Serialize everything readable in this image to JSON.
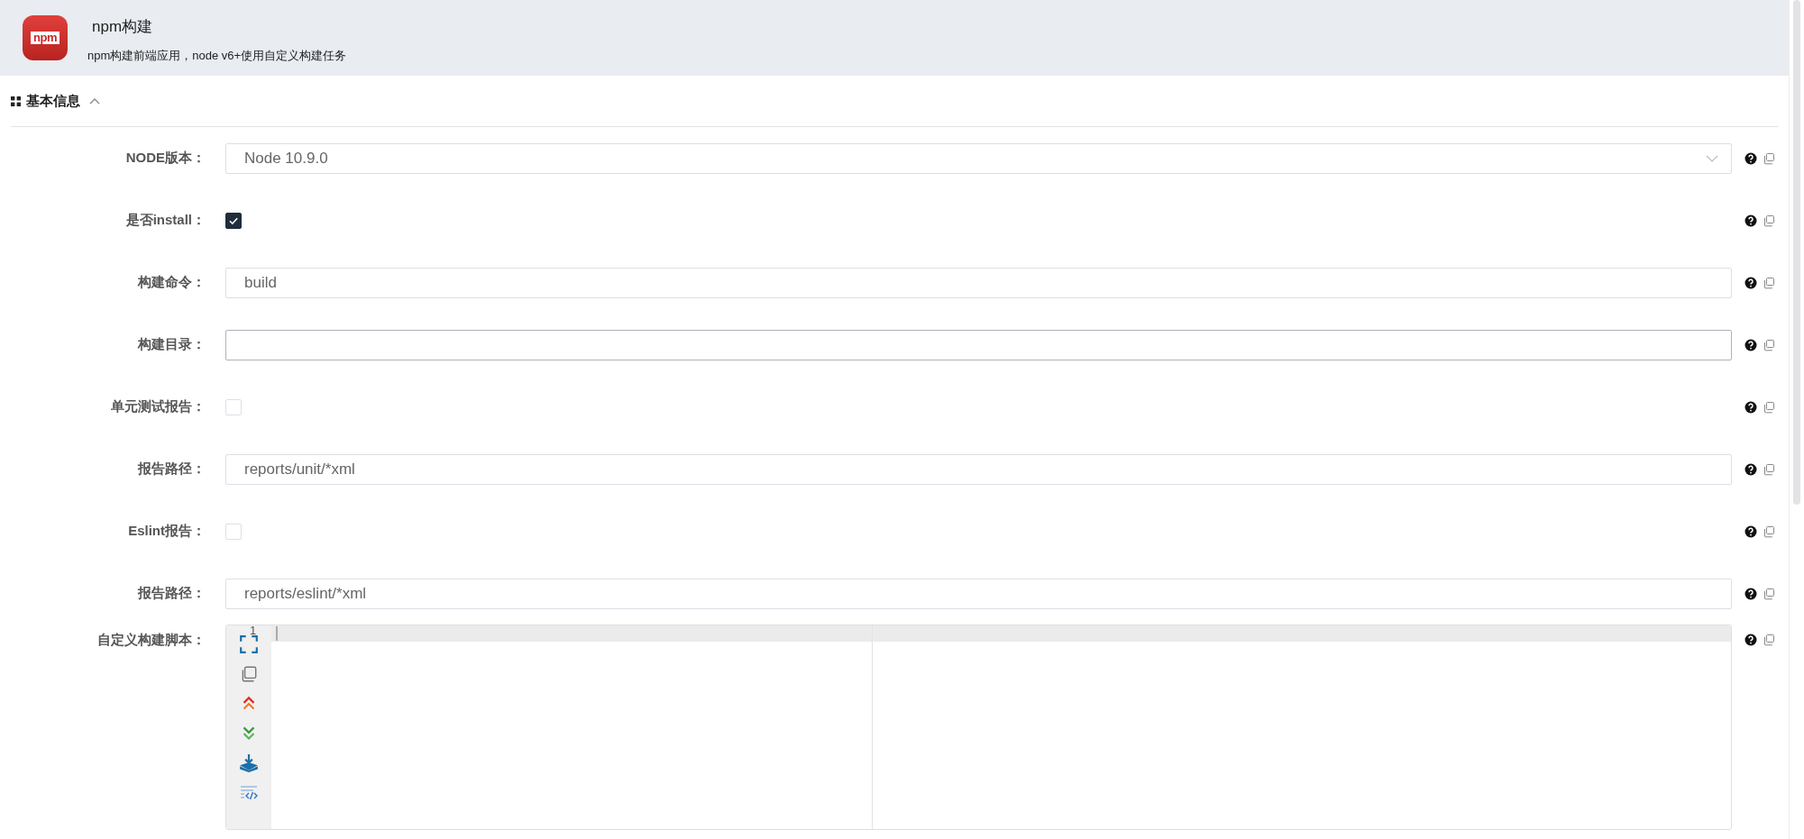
{
  "header": {
    "logo": "npm",
    "title": "npm构建",
    "description": "npm构建前端应用，node v6+使用自定义构建任务"
  },
  "section": {
    "title": "基本信息",
    "expanded": true
  },
  "fields": [
    {
      "kind": "select",
      "label": "NODE版本：",
      "value": "Node 10.9.0"
    },
    {
      "kind": "checkbox",
      "label": "是否install：",
      "checked": true
    },
    {
      "kind": "input",
      "label": "构建命令：",
      "value": "build",
      "focused": false
    },
    {
      "kind": "input",
      "label": "构建目录：",
      "focused": true
    },
    {
      "kind": "checkbox",
      "label": "单元测试报告：",
      "checked": false
    },
    {
      "kind": "input",
      "label": "报告路径：",
      "value": "reports/unit/*xml",
      "focused": false
    },
    {
      "kind": "checkbox",
      "label": "Eslint报告：",
      "checked": false
    },
    {
      "kind": "input",
      "label": "报告路径：",
      "value": "reports/eslint/*xml",
      "focused": false
    },
    {
      "kind": "editor",
      "label": "自定义构建脚本：",
      "line_number": "1"
    }
  ]
}
